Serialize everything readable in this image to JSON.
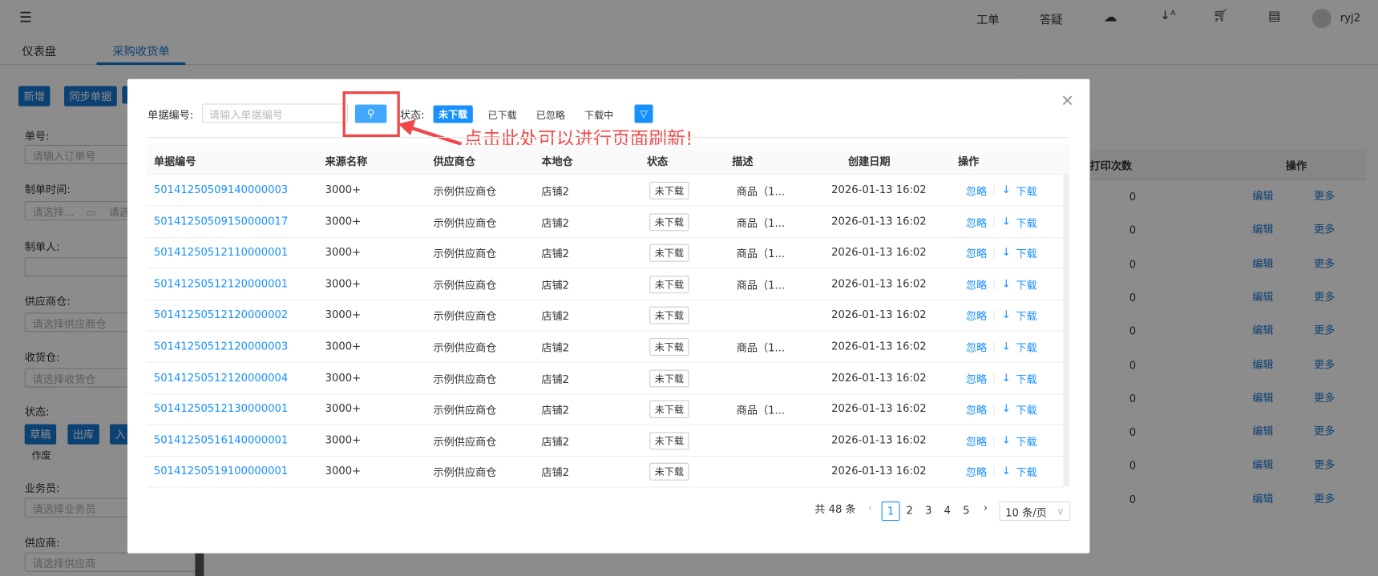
{
  "topbar": {
    "items": [
      "工单",
      "答疑"
    ],
    "user": "ryj2"
  },
  "tabs": [
    "仪表盘",
    "采购收货单"
  ],
  "toolbar": {
    "add": "新增",
    "sync": "同步单据"
  },
  "filters": {
    "order_no": {
      "label": "单号:",
      "placeholder": "请输入订单号"
    },
    "made_time": {
      "label": "制单时间:",
      "placeholder_start": "请选择...",
      "placeholder_end": "请选"
    },
    "maker": {
      "label": "制单人:"
    },
    "supplier_wh": {
      "label": "供应商仓:",
      "placeholder": "请选择供应商仓"
    },
    "receive_wh": {
      "label": "收货仓:",
      "placeholder": "请选择收货仓"
    },
    "status": {
      "label": "状态:",
      "options": [
        "草稿",
        "出库",
        "入",
        "作废"
      ]
    },
    "salesman": {
      "label": "业务员:",
      "placeholder": "请选择业务员"
    },
    "supplier": {
      "label": "供应商:",
      "placeholder": "请选择供应商"
    }
  },
  "bg_table": {
    "headers": [
      "打印次数",
      "操作"
    ],
    "print_count": "0",
    "edit": "编辑",
    "more": "更多"
  },
  "modal": {
    "search_label": "单据编号:",
    "search_placeholder": "请输入单据编号",
    "status_label": "状态:",
    "status_options": [
      "未下载",
      "已下载",
      "已忽略",
      "下载中"
    ],
    "annotation": "点击此处可以进行页面刷新!",
    "columns": [
      "单据编号",
      "来源名称",
      "供应商仓",
      "本地仓",
      "状态",
      "描述",
      "创建日期",
      "操作"
    ],
    "rows": [
      {
        "id": "50141250509140000003",
        "source": "3000+",
        "supplier": "示例供应商仓",
        "local": "店铺2",
        "status": "未下载",
        "desc": "商品（1...",
        "date": "2026-01-13 16:02"
      },
      {
        "id": "50141250509150000017",
        "source": "3000+",
        "supplier": "示例供应商仓",
        "local": "店铺2",
        "status": "未下载",
        "desc": "商品（1...",
        "date": "2026-01-13 16:02"
      },
      {
        "id": "50141250512110000001",
        "source": "3000+",
        "supplier": "示例供应商仓",
        "local": "店铺2",
        "status": "未下载",
        "desc": "商品（1...",
        "date": "2026-01-13 16:02"
      },
      {
        "id": "50141250512120000001",
        "source": "3000+",
        "supplier": "示例供应商仓",
        "local": "店铺2",
        "status": "未下载",
        "desc": "商品（1...",
        "date": "2026-01-13 16:02"
      },
      {
        "id": "50141250512120000002",
        "source": "3000+",
        "supplier": "示例供应商仓",
        "local": "店铺2",
        "status": "未下载",
        "desc": "",
        "date": "2026-01-13 16:02"
      },
      {
        "id": "50141250512120000003",
        "source": "3000+",
        "supplier": "示例供应商仓",
        "local": "店铺2",
        "status": "未下载",
        "desc": "商品（1...",
        "date": "2026-01-13 16:02"
      },
      {
        "id": "50141250512120000004",
        "source": "3000+",
        "supplier": "示例供应商仓",
        "local": "店铺2",
        "status": "未下载",
        "desc": "",
        "date": "2026-01-13 16:02"
      },
      {
        "id": "50141250512130000001",
        "source": "3000+",
        "supplier": "示例供应商仓",
        "local": "店铺2",
        "status": "未下载",
        "desc": "商品（1...",
        "date": "2026-01-13 16:02"
      },
      {
        "id": "50141250516140000001",
        "source": "3000+",
        "supplier": "示例供应商仓",
        "local": "店铺2",
        "status": "未下载",
        "desc": "",
        "date": "2026-01-13 16:02"
      },
      {
        "id": "50141250519100000001",
        "source": "3000+",
        "supplier": "示例供应商仓",
        "local": "店铺2",
        "status": "未下载",
        "desc": "",
        "date": "2026-01-13 16:02"
      }
    ],
    "actions": {
      "ignore": "忽略",
      "download": "下载"
    },
    "pagination": {
      "total": "共 48 条",
      "pages": [
        "1",
        "2",
        "3",
        "4",
        "5"
      ],
      "current": "1",
      "page_size": "10 条/页"
    }
  },
  "colors": {
    "accent": "#1890ff",
    "annotation": "#f04848"
  }
}
